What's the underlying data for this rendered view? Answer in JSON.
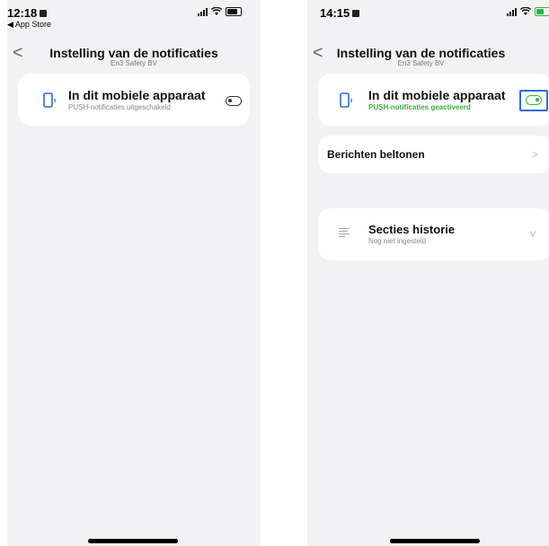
{
  "left": {
    "status": {
      "time": "12:18",
      "back_app": "◀ App Store"
    },
    "nav": {
      "back": "<",
      "title": "Instelling van de notificaties",
      "subtitle": "En3 Safety BV"
    },
    "device_card": {
      "icon": "smartphone-notification-icon",
      "title": "In dit mobiele apparaat",
      "subtitle": "PUSH-notificaties uitgeschakeld",
      "toggle_on": false
    }
  },
  "right": {
    "status": {
      "time": "14:15"
    },
    "nav": {
      "back": "<",
      "title": "Instelling van de notificaties",
      "subtitle": "En3 Safety BV"
    },
    "device_card": {
      "icon": "smartphone-notification-icon",
      "title": "In dit mobiele apparaat",
      "subtitle": "PUSH-notificaties geactiveerd",
      "toggle_on": true,
      "highlight_color": "#2f6bd8"
    },
    "ringtones_row": {
      "label": "Berichten beltonen",
      "chevron": ">"
    },
    "history_card": {
      "icon": "list-lines-icon",
      "title": "Secties historie",
      "subtitle": "Nog niet ingesteld",
      "chevron": "v"
    }
  },
  "colors": {
    "accent_green": "#3fae3f",
    "background": "#f2f2f4",
    "icon_blue": "#2f6bd8"
  }
}
